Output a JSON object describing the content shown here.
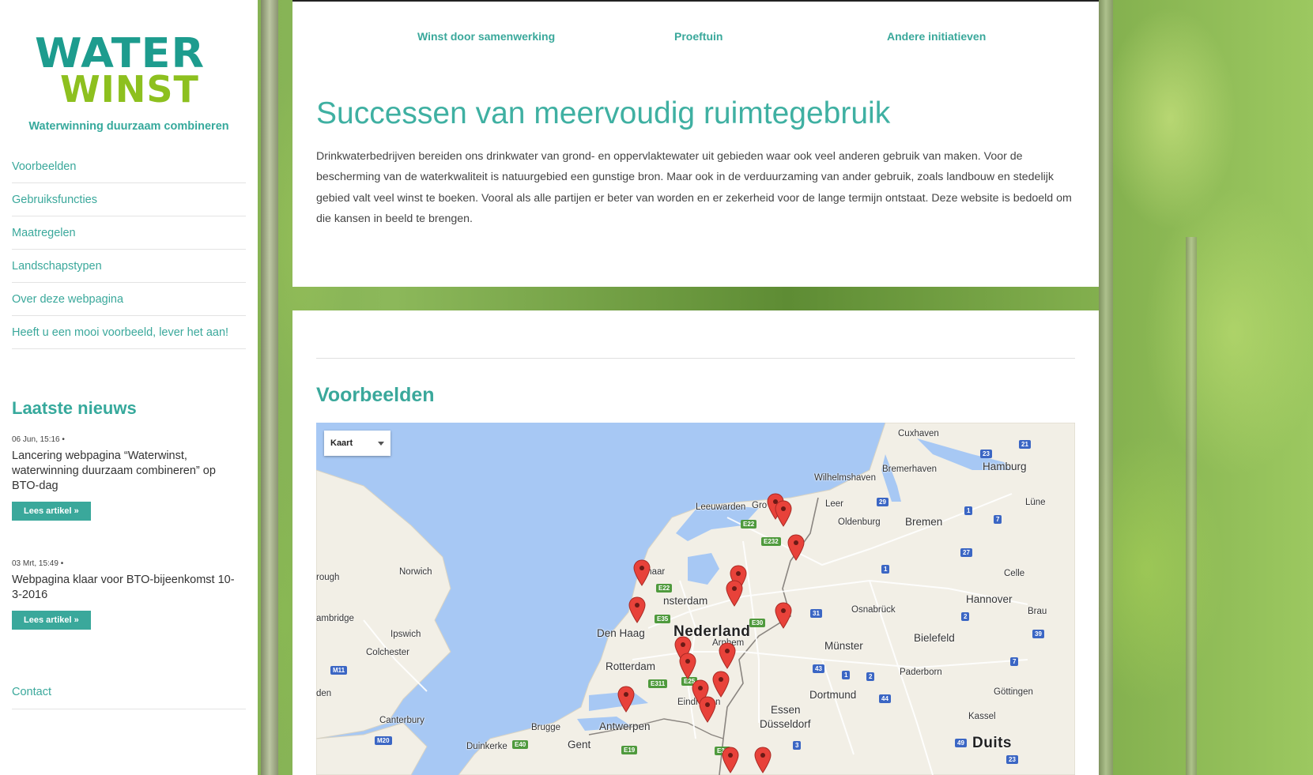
{
  "site": {
    "logo_line1": "WATER",
    "logo_line2": "WINST",
    "tagline": "Waterwinning duurzaam combineren"
  },
  "sidebar": {
    "nav": [
      {
        "label": "Voorbeelden"
      },
      {
        "label": "Gebruiksfuncties"
      },
      {
        "label": "Maatregelen"
      },
      {
        "label": "Landschapstypen"
      },
      {
        "label": "Over deze webpagina"
      },
      {
        "label": "Heeft u een mooi voorbeeld, lever het aan!"
      }
    ],
    "news_heading": "Laatste nieuws",
    "news": [
      {
        "meta": "06 Jun, 15:16 •",
        "title": "Lancering webpagina “Waterwinst, waterwinning duurzaam combineren” op BTO-dag",
        "button": "Lees artikel »"
      },
      {
        "meta": "03 Mrt, 15:49 •",
        "title": "Webpagina klaar voor BTO-bijeenkomst 10-3-2016",
        "button": "Lees artikel »"
      }
    ],
    "contact": "Contact"
  },
  "topnav": [
    {
      "label": "Winst door samenwerking"
    },
    {
      "label": "Proeftuin"
    },
    {
      "label": "Andere initiatieven"
    }
  ],
  "main": {
    "title": "Successen van meervoudig ruimtegebruik",
    "intro": "Drinkwaterbedrijven bereiden ons drinkwater van grond- en oppervlaktewater uit gebieden waar ook veel anderen gebruik van maken. Voor de bescherming van de waterkwaliteit is natuurgebied een gunstige bron. Maar ook in de verduurzaming van ander gebruik, zoals landbouw en stedelijk gebied valt veel winst te boeken. Vooral als alle partijen er beter van worden en er zekerheid voor de lange termijn ontstaat. Deze website is bedoeld om die kansen in beeld te brengen.",
    "section_title": "Voorbeelden"
  },
  "map": {
    "type_selector": "Kaart",
    "labels": [
      {
        "text": "Cuxhaven",
        "kind": "town"
      },
      {
        "text": "Wilhelmshaven",
        "kind": "town"
      },
      {
        "text": "Bremerhaven",
        "kind": "town"
      },
      {
        "text": "Hamburg",
        "kind": "city"
      },
      {
        "text": "Leeuwarden",
        "kind": "town"
      },
      {
        "text": "Gro",
        "kind": "town"
      },
      {
        "text": "n",
        "kind": "town"
      },
      {
        "text": "Leer",
        "kind": "town"
      },
      {
        "text": "Oldenburg",
        "kind": "town"
      },
      {
        "text": "Bremen",
        "kind": "city"
      },
      {
        "text": "Lüne",
        "kind": "town"
      },
      {
        "text": "maar",
        "kind": "town"
      },
      {
        "text": "Norwich",
        "kind": "town"
      },
      {
        "text": "rough",
        "kind": "town"
      },
      {
        "text": "nsterdam",
        "kind": "city"
      },
      {
        "text": "Celle",
        "kind": "town"
      },
      {
        "text": "Hannover",
        "kind": "city"
      },
      {
        "text": "Osnabrück",
        "kind": "town"
      },
      {
        "text": "Brau",
        "kind": "town"
      },
      {
        "text": "ambridge",
        "kind": "town"
      },
      {
        "text": "Ipswich",
        "kind": "town"
      },
      {
        "text": "Den Haag",
        "kind": "city"
      },
      {
        "text": "Nederland",
        "kind": "country"
      },
      {
        "text": "Bielefeld",
        "kind": "city"
      },
      {
        "text": "Arnhem",
        "kind": "town"
      },
      {
        "text": "Colchester",
        "kind": "town"
      },
      {
        "text": "Münster",
        "kind": "city"
      },
      {
        "text": "Rotterdam",
        "kind": "city"
      },
      {
        "text": "Paderborn",
        "kind": "town"
      },
      {
        "text": "den",
        "kind": "town"
      },
      {
        "text": "Dortmund",
        "kind": "city"
      },
      {
        "text": "Göttingen",
        "kind": "town"
      },
      {
        "text": "Eindhoven",
        "kind": "town"
      },
      {
        "text": "Essen",
        "kind": "city"
      },
      {
        "text": "Canterbury",
        "kind": "town"
      },
      {
        "text": "Kassel",
        "kind": "town"
      },
      {
        "text": "Brugge",
        "kind": "town"
      },
      {
        "text": "Antwerpen",
        "kind": "city"
      },
      {
        "text": "Düsseldorf",
        "kind": "city"
      },
      {
        "text": "Duinkerke",
        "kind": "town"
      },
      {
        "text": "Gent",
        "kind": "city"
      },
      {
        "text": "Duits",
        "kind": "country"
      }
    ],
    "shields": [
      {
        "text": "23",
        "color": "blue"
      },
      {
        "text": "21",
        "color": "blue"
      },
      {
        "text": "29",
        "color": "blue"
      },
      {
        "text": "1",
        "color": "blue"
      },
      {
        "text": "7",
        "color": "blue"
      },
      {
        "text": "27",
        "color": "blue"
      },
      {
        "text": "E22",
        "color": "green"
      },
      {
        "text": "E232",
        "color": "green"
      },
      {
        "text": "1",
        "color": "blue"
      },
      {
        "text": "E22",
        "color": "green"
      },
      {
        "text": "E35",
        "color": "green"
      },
      {
        "text": "31",
        "color": "blue"
      },
      {
        "text": "2",
        "color": "blue"
      },
      {
        "text": "E30",
        "color": "green"
      },
      {
        "text": "39",
        "color": "blue"
      },
      {
        "text": "43",
        "color": "blue"
      },
      {
        "text": "1",
        "color": "blue"
      },
      {
        "text": "2",
        "color": "blue"
      },
      {
        "text": "7",
        "color": "blue"
      },
      {
        "text": "M11",
        "color": "blue"
      },
      {
        "text": "E311",
        "color": "green"
      },
      {
        "text": "E25",
        "color": "green"
      },
      {
        "text": "44",
        "color": "blue"
      },
      {
        "text": "M20",
        "color": "blue"
      },
      {
        "text": "E40",
        "color": "green"
      },
      {
        "text": "E19",
        "color": "green"
      },
      {
        "text": "3",
        "color": "blue"
      },
      {
        "text": "49",
        "color": "blue"
      },
      {
        "text": "23",
        "color": "blue"
      },
      {
        "text": "E32",
        "color": "green"
      }
    ],
    "markers": 18
  },
  "colors": {
    "accent": "#3aa89b",
    "logo_teal": "#1d9c8e",
    "logo_green": "#8dc01f",
    "marker_red": "#e8423a",
    "sea": "#a7c8f4",
    "land": "#f2efe6"
  }
}
